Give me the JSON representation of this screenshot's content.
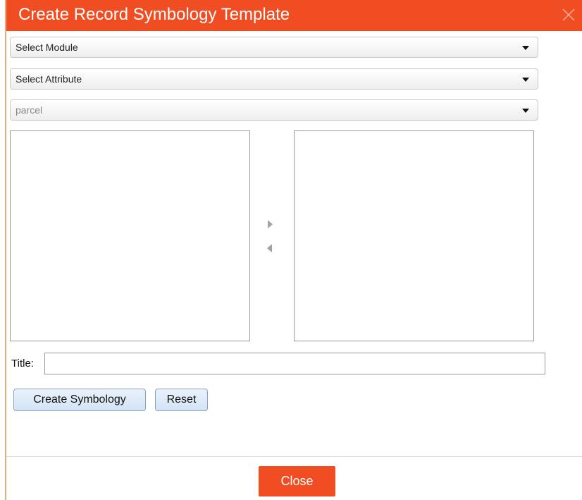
{
  "dialog": {
    "title": "Create Record Symbology Template",
    "close_icon": "close-icon",
    "accent_color": "#f04d23"
  },
  "selects": {
    "module": {
      "value": "Select Module"
    },
    "attribute": {
      "value": "Select Attribute"
    },
    "layer": {
      "value": "parcel",
      "disabled": true
    }
  },
  "transfer": {
    "move_right_icon": "arrow-right-icon",
    "move_left_icon": "arrow-left-icon"
  },
  "title_field": {
    "label": "Title:",
    "value": ""
  },
  "buttons": {
    "create": "Create Symbology",
    "reset": "Reset",
    "close": "Close"
  }
}
